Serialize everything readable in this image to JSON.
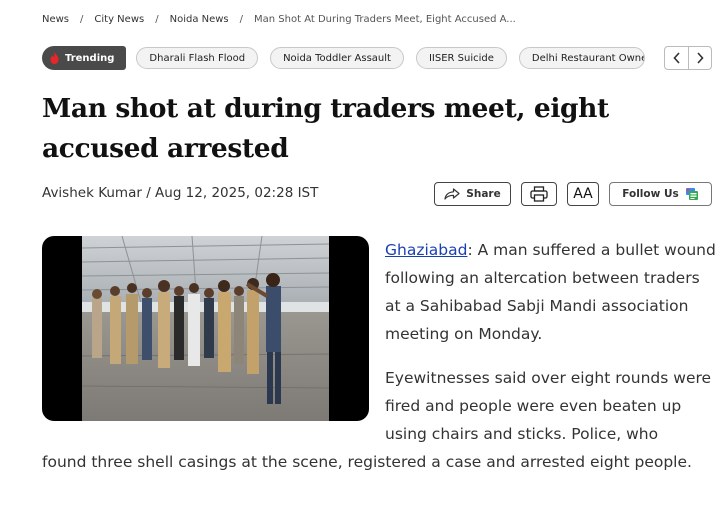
{
  "breadcrumb": {
    "items": [
      "News",
      "City News",
      "Noida News"
    ],
    "current": "Man Shot At During Traders Meet, Eight Accused A..."
  },
  "trending": {
    "label": "Trending",
    "topics": [
      "Dharali Flash Flood",
      "Noida Toddler Assault",
      "IISER Suicide",
      "Delhi Restaurant Owne"
    ]
  },
  "article": {
    "headline": "Man shot at during traders meet, eight accused arrested",
    "byline": "Avishek Kumar / Aug 12, 2025, 02:28 IST",
    "location_link": "Ghaziabad",
    "p1_rest": ": A man suffered a bullet wound following an altercation between traders at a Sahibabad Sabji Mandi association meeting on Monday.",
    "p2_first": "Eyewitnesses said over eight rounds were fired and people were even beaten up using chairs and sticks. Police, who",
    "p2_rest": "found three shell casings at the scene, registered a case and arrested eight people."
  },
  "tools": {
    "share_label": "Share",
    "font_size_label": "AA",
    "follow_label": "Follow Us"
  },
  "colors": {
    "trending_bg": "#4a4a4a",
    "flame": "#e8262a",
    "link": "#1a3fb0"
  },
  "icons": [
    "flame-icon",
    "chevron-left-icon",
    "chevron-right-icon",
    "share-icon",
    "print-icon",
    "google-news-icon"
  ]
}
